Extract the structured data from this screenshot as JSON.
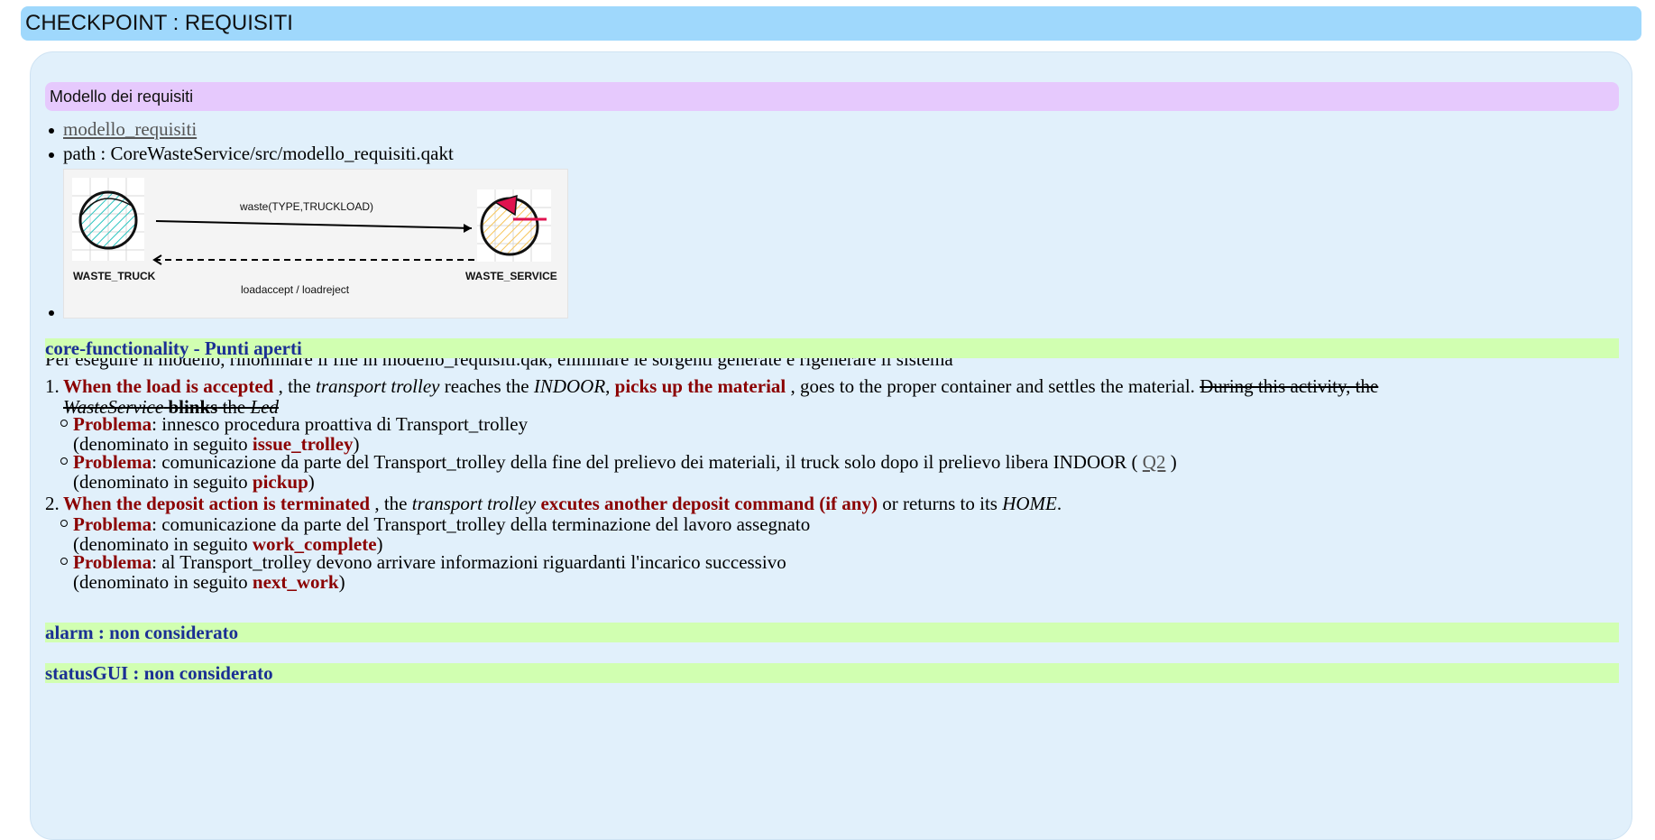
{
  "header": {
    "title": "CHECKPOINT : REQUISITI"
  },
  "requirements_model": {
    "title": "Modello dei requisiti",
    "link_label": "modello_requisiti",
    "path_text": "path : CoreWasteService/src/modello_requisiti.qakt",
    "diagram": {
      "left_label": "WASTE_TRUCK",
      "right_label": "WASTE_SERVICE",
      "top_message": "waste(TYPE,TRUCKLOAD)",
      "bottom_message": "loadaccept / loadreject"
    },
    "instructions": "Per eseguire il modello, rinominare il file in modello_requisiti.qak, eliminare le sorgenti generate e rigenerare il sistema"
  },
  "core": {
    "heading": "core-functionality - Punti aperti",
    "items": [
      {
        "number": "1.",
        "lead": "When the load is accepted",
        "t1": " , the ",
        "i1": "transport trolley",
        "t2": " reaches the ",
        "i2": "INDOOR",
        "t3": ", ",
        "bold2": "picks up the material",
        "t4": " , goes to the proper container and settles the material. ",
        "strike1": "During this activity, the",
        "strike_i": "WasteService",
        "strike_b": "blinks",
        "strike2": " the ",
        "strike_i2": "Led",
        "subs": [
          {
            "label": "Problema",
            "text": ": innesco procedura proattiva di Transport_trolley",
            "line2": "(denominato in seguito ",
            "term": "issue_trolley",
            "close": ")"
          },
          {
            "label": "Problema",
            "text": ": comunicazione da parte del Transport_trolley della fine del prelievo dei materiali, il truck solo dopo il prelievo libera INDOOR ( ",
            "link": "Q2",
            "after": " )",
            "line2": "(denominato in seguito ",
            "term": "pickup",
            "close": ")"
          }
        ]
      },
      {
        "number": "2.",
        "lead": "When the deposit action is terminated",
        "t1": " , the ",
        "i1": "transport trolley",
        "t2": " ",
        "bold2": "excutes another deposit command (if any)",
        "t3": " or returns to its ",
        "i2": "HOME",
        "t4": ".",
        "subs": [
          {
            "label": "Problema",
            "text": ": comunicazione da parte del Transport_trolley della terminazione del lavoro assegnato",
            "line2": "(denominato in seguito ",
            "term": "work_complete",
            "close": ")"
          },
          {
            "label": "Problema",
            "text": ": al Transport_trolley devono arrivare informazioni riguardanti l'incarico successivo",
            "line2": "(denominato in seguito ",
            "term": "next_work",
            "close": ")"
          }
        ]
      }
    ]
  },
  "alarm": {
    "heading": "alarm : non considerato"
  },
  "status_gui": {
    "heading": "statusGUI : non considerato"
  }
}
